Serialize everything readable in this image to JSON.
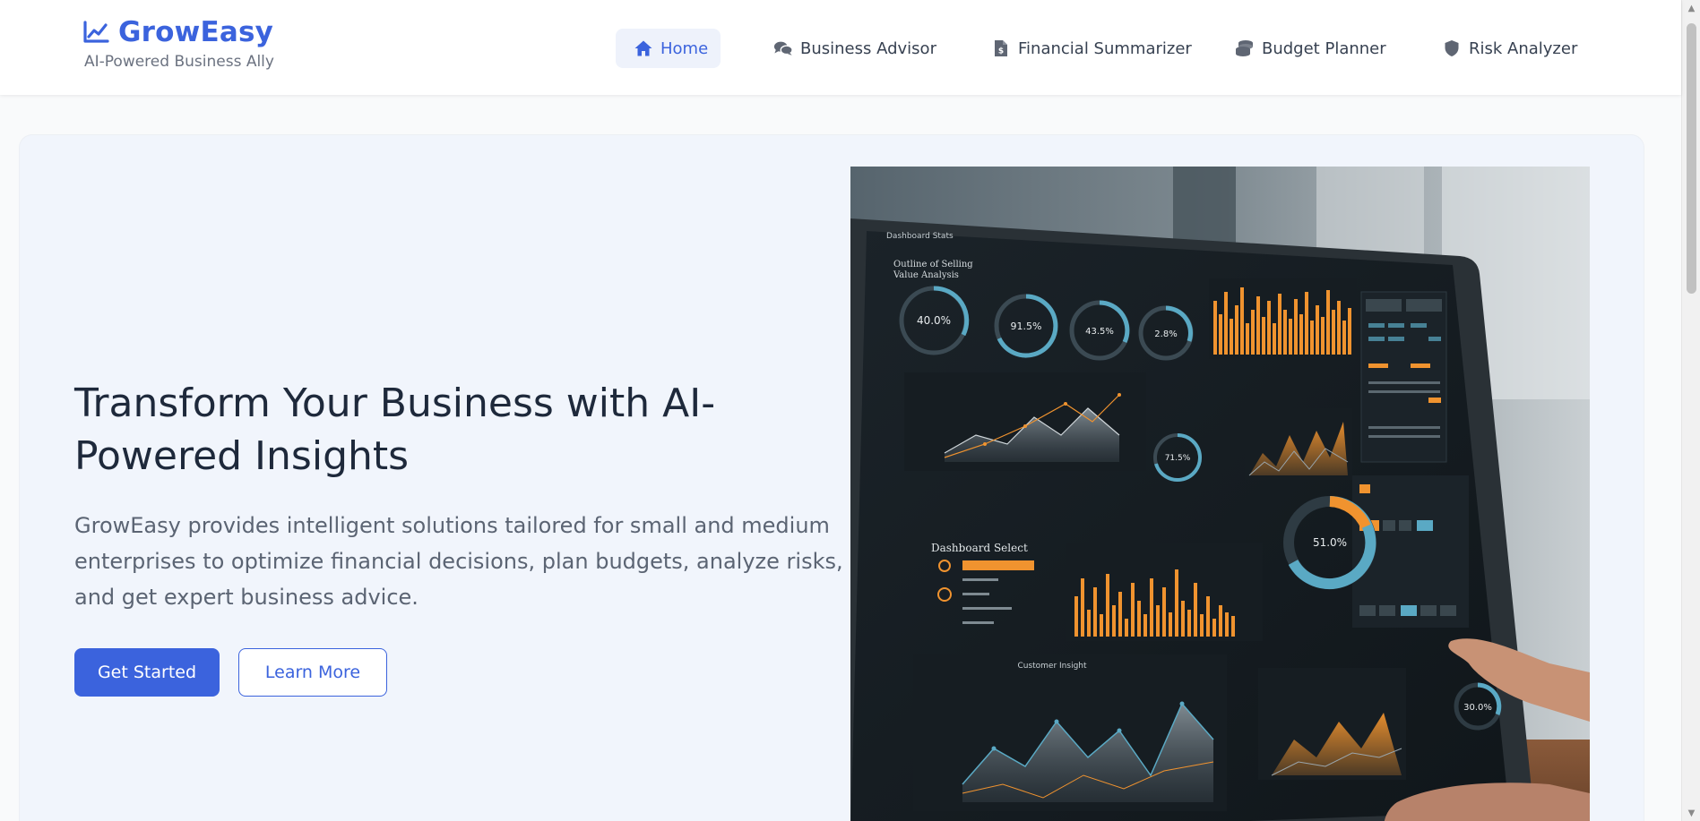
{
  "brand": {
    "name": "GrowEasy",
    "tagline": "AI-Powered Business Ally",
    "icon": "chart-line-icon",
    "color": "#3b63dd"
  },
  "nav": {
    "items": [
      {
        "label": "Home",
        "icon": "home-icon",
        "active": true
      },
      {
        "label": "Business Advisor",
        "icon": "comments-icon",
        "active": false
      },
      {
        "label": "Financial Summarizer",
        "icon": "file-invoice-icon",
        "active": false
      },
      {
        "label": "Budget Planner",
        "icon": "coins-icon",
        "active": false
      },
      {
        "label": "Risk Analyzer",
        "icon": "shield-icon",
        "active": false
      }
    ]
  },
  "hero": {
    "title": "Transform Your Business with AI-Powered Insights",
    "description": "GrowEasy provides intelligent solutions tailored for small and medium enterprises to optimize financial decisions, plan budgets, analyze risks, and get expert business advice.",
    "primary_button": "Get Started",
    "secondary_button": "Learn More",
    "image": {
      "kpis": [
        "40.0%",
        "91.5%",
        "43.5%",
        "2.8%",
        "71.5%",
        "51.0%",
        "30.0%"
      ],
      "panel_titles": [
        "Dashboard Select",
        "Customer Insight"
      ]
    }
  },
  "colors": {
    "accent": "#3b63dd",
    "hero_bg": "#f1f5fc",
    "dashboard_orange": "#f0932f",
    "dashboard_teal": "#5aa9c4"
  }
}
